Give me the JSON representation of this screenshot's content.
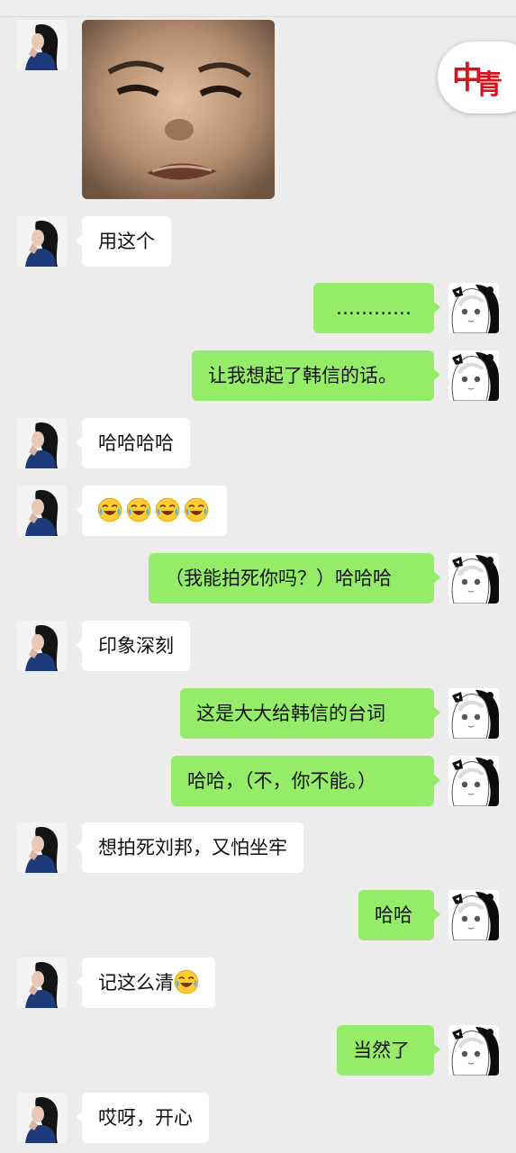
{
  "messages": [
    {
      "side": "in",
      "type": "sticker",
      "sticker": "crying-child-face"
    },
    {
      "side": "in",
      "type": "text",
      "text": "用这个"
    },
    {
      "side": "out",
      "type": "text",
      "text": "…………"
    },
    {
      "side": "out",
      "type": "text",
      "text": "让我想起了韩信的话。"
    },
    {
      "side": "in",
      "type": "text",
      "text": "哈哈哈哈"
    },
    {
      "side": "in",
      "type": "emoji",
      "emojis": [
        "laugh-cry-emoji",
        "laugh-cry-emoji",
        "laugh-cry-emoji",
        "laugh-cry-emoji"
      ]
    },
    {
      "side": "out",
      "type": "text",
      "text": "（我能拍死你吗？）哈哈哈"
    },
    {
      "side": "in",
      "type": "text",
      "text": "印象深刻"
    },
    {
      "side": "out",
      "type": "text",
      "text": "这是大大给韩信的台词"
    },
    {
      "side": "out",
      "type": "text",
      "text": "哈哈，（不，你不能。）"
    },
    {
      "side": "in",
      "type": "text",
      "text": "想拍死刘邦，又怕坐牢"
    },
    {
      "side": "out",
      "type": "text",
      "text": "哈哈"
    },
    {
      "side": "in",
      "type": "text",
      "text": "记这么清",
      "emoji": "laugh-cry-emoji"
    },
    {
      "side": "out",
      "type": "text",
      "text": "当然了"
    },
    {
      "side": "in",
      "type": "text",
      "text": "哎呀，开心"
    }
  ],
  "floating_badge": {
    "icon": "red-seal-logo-icon"
  },
  "colors": {
    "background": "#ececec",
    "incoming_bubble": "#ffffff",
    "outgoing_bubble": "#95ec69"
  }
}
